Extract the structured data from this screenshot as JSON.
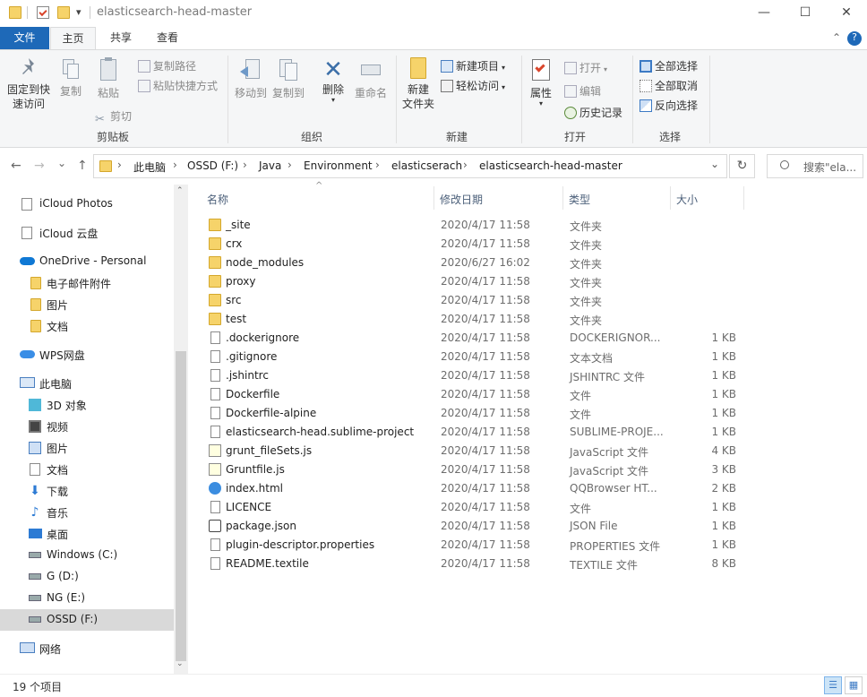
{
  "window": {
    "title": "elasticsearch-head-master",
    "minimize": "—",
    "maximize": "☐",
    "close": "✕",
    "qa_dropdown": "▾"
  },
  "tabs": {
    "file": "文件",
    "home": "主页",
    "share": "共享",
    "view": "查看",
    "collapse": "⌃",
    "help": "?"
  },
  "ribbon": {
    "clipboard": {
      "pin_line1": "固定到快",
      "pin_line2": "速访问",
      "copy": "复制",
      "paste": "粘贴",
      "copy_path": "复制路径",
      "paste_shortcut": "粘贴快捷方式",
      "cut": "剪切",
      "label": "剪贴板"
    },
    "organize": {
      "move_to": "移动到",
      "copy_to": "复制到",
      "delete": "删除",
      "rename": "重命名",
      "label": "组织"
    },
    "new": {
      "new_folder_line1": "新建",
      "new_folder_line2": "文件夹",
      "new_item": "新建项目",
      "easy_access": "轻松访问",
      "label": "新建"
    },
    "open": {
      "properties": "属性",
      "open": "打开",
      "edit": "编辑",
      "history": "历史记录",
      "label": "打开"
    },
    "select": {
      "select_all": "全部选择",
      "select_none": "全部取消",
      "invert": "反向选择",
      "label": "选择"
    }
  },
  "address": {
    "back": "←",
    "forward": "→",
    "recent": "⌄",
    "up": "↑",
    "crumbs": [
      "此电脑",
      "OSSD (F:)",
      "Java",
      "Environment",
      "elasticserach",
      "elasticsearch-head-master"
    ],
    "sep": "›",
    "dropdown": "⌄",
    "refresh": "↻",
    "search_placeholder": "搜索\"ela..."
  },
  "nav": {
    "items": [
      {
        "label": "iCloud Photos"
      },
      {
        "label": "iCloud 云盘"
      },
      {
        "label": "OneDrive - Personal"
      },
      {
        "label": "电子邮件附件"
      },
      {
        "label": "图片"
      },
      {
        "label": "文档"
      },
      {
        "label": "WPS网盘"
      },
      {
        "label": "此电脑"
      },
      {
        "label": "3D 对象"
      },
      {
        "label": "视频"
      },
      {
        "label": "图片"
      },
      {
        "label": "文档"
      },
      {
        "label": "下载"
      },
      {
        "label": "音乐"
      },
      {
        "label": "桌面"
      },
      {
        "label": "Windows (C:)"
      },
      {
        "label": "G (D:)"
      },
      {
        "label": "NG (E:)"
      },
      {
        "label": "OSSD (F:)"
      },
      {
        "label": "网络"
      }
    ],
    "scroll_up": "⌃",
    "scroll_down": "⌄"
  },
  "columns": {
    "name": "名称",
    "date": "修改日期",
    "type": "类型",
    "size": "大小",
    "sort": "^"
  },
  "files": [
    {
      "name": "_site",
      "date": "2020/4/17 11:58",
      "type": "文件夹",
      "size": ""
    },
    {
      "name": "crx",
      "date": "2020/4/17 11:58",
      "type": "文件夹",
      "size": ""
    },
    {
      "name": "node_modules",
      "date": "2020/6/27 16:02",
      "type": "文件夹",
      "size": ""
    },
    {
      "name": "proxy",
      "date": "2020/4/17 11:58",
      "type": "文件夹",
      "size": ""
    },
    {
      "name": "src",
      "date": "2020/4/17 11:58",
      "type": "文件夹",
      "size": ""
    },
    {
      "name": "test",
      "date": "2020/4/17 11:58",
      "type": "文件夹",
      "size": ""
    },
    {
      "name": ".dockerignore",
      "date": "2020/4/17 11:58",
      "type": "DOCKERIGNOR...",
      "size": "1 KB"
    },
    {
      "name": ".gitignore",
      "date": "2020/4/17 11:58",
      "type": "文本文档",
      "size": "1 KB"
    },
    {
      "name": ".jshintrc",
      "date": "2020/4/17 11:58",
      "type": "JSHINTRC 文件",
      "size": "1 KB"
    },
    {
      "name": "Dockerfile",
      "date": "2020/4/17 11:58",
      "type": "文件",
      "size": "1 KB"
    },
    {
      "name": "Dockerfile-alpine",
      "date": "2020/4/17 11:58",
      "type": "文件",
      "size": "1 KB"
    },
    {
      "name": "elasticsearch-head.sublime-project",
      "date": "2020/4/17 11:58",
      "type": "SUBLIME-PROJE...",
      "size": "1 KB"
    },
    {
      "name": "grunt_fileSets.js",
      "date": "2020/4/17 11:58",
      "type": "JavaScript 文件",
      "size": "4 KB"
    },
    {
      "name": "Gruntfile.js",
      "date": "2020/4/17 11:58",
      "type": "JavaScript 文件",
      "size": "3 KB"
    },
    {
      "name": "index.html",
      "date": "2020/4/17 11:58",
      "type": "QQBrowser HT...",
      "size": "2 KB"
    },
    {
      "name": "LICENCE",
      "date": "2020/4/17 11:58",
      "type": "文件",
      "size": "1 KB"
    },
    {
      "name": "package.json",
      "date": "2020/4/17 11:58",
      "type": "JSON File",
      "size": "1 KB"
    },
    {
      "name": "plugin-descriptor.properties",
      "date": "2020/4/17 11:58",
      "type": "PROPERTIES 文件",
      "size": "1 KB"
    },
    {
      "name": "README.textile",
      "date": "2020/4/17 11:58",
      "type": "TEXTILE 文件",
      "size": "8 KB"
    }
  ],
  "status": {
    "count": "19 个项目"
  }
}
